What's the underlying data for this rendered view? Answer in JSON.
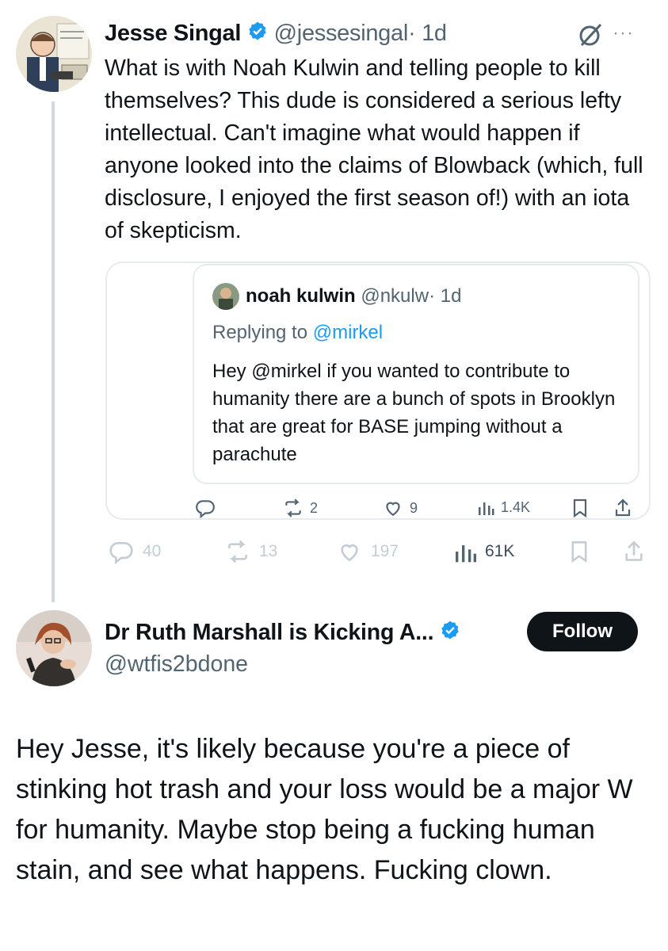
{
  "tweet1": {
    "display_name": "Jesse Singal",
    "handle": "@jessesingal",
    "time": "· 1d",
    "more_label": "···",
    "text": "What is with Noah Kulwin and telling people to kill themselves? This dude is considered a serious lefty intellectual. Can't imagine what would happen if anyone looked into the claims of Blowback (which, full disclosure, I enjoyed the first season of!) with an iota of skepticism.",
    "actions": {
      "replies": "40",
      "reposts": "13",
      "likes": "197",
      "views": "61K"
    }
  },
  "quoted": {
    "display_name": "noah kulwin",
    "handle": "@nkulw",
    "time": "· 1d",
    "replying_prefix": "Replying to ",
    "replying_to": "@mirkel",
    "text": "Hey @mirkel if you wanted to contribute to humanity there are a bunch of spots in Brooklyn that are great for BASE jumping without a parachute",
    "actions": {
      "reposts": "2",
      "likes": "9",
      "views": "1.4K"
    }
  },
  "tweet2": {
    "display_name": "Dr Ruth Marshall is Kicking A...",
    "handle": "@wtfis2bdone",
    "follow_label": "Follow",
    "text": "Hey Jesse, it's likely because you're a piece of stinking hot trash and your loss would be a major W for humanity. Maybe stop being a fucking human stain, and see what happens. Fucking clown."
  },
  "colors": {
    "verified": "#1d9bf0",
    "link": "#1d9bf0",
    "secondary_text": "#536471",
    "follow_bg": "#0f1419"
  },
  "icons": [
    "verified-badge-icon",
    "grok-icon",
    "more-icon",
    "reply-icon",
    "repost-icon",
    "like-icon",
    "views-icon",
    "bookmark-icon",
    "share-icon"
  ]
}
